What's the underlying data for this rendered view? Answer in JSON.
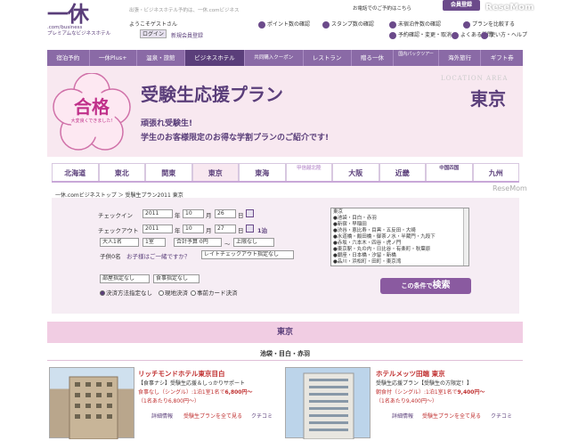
{
  "header": {
    "logo_main": "一休",
    "logo_sub1": ".com/business",
    "logo_sub2": "プレミアムなビジネスホテル",
    "top_crumb": "出張・ビジネスホテル予約は、一休.comビジネス",
    "guest_text": "ようこそゲストさん",
    "login_label": "ログイン",
    "register_label": "新規会員登録",
    "phone_text": "お電話でのご予約はこちら",
    "member_login": "会員登録",
    "links": [
      "ポイント数の確認",
      "スタンプ数の確認",
      "未宿泊件数の確認",
      "プランを比較する",
      "予約確認・変更・取消",
      "よくある質問",
      "使い方・ヘルプ"
    ]
  },
  "nav": {
    "items": [
      "宿泊予約",
      "一休Plus+",
      "温泉・旅館",
      "ビジネスホテル",
      "共同購入クーポン",
      "レストラン",
      "贈る一休",
      "国内パックツアー",
      "海外旅行",
      "ギフト券"
    ],
    "active_index": 3
  },
  "hero": {
    "badge_big": "合格",
    "badge_small": "大変良くできました!",
    "title": "受験生応援プラン",
    "sub1": "頑張れ受験生!",
    "sub2": "学生のお客様限定のお得な学割プランのご紹介です!",
    "location_area": "LOCATION AREA",
    "city": "東京"
  },
  "tabs": {
    "items": [
      "北海道",
      "東北",
      "関東",
      "東京",
      "東海",
      "甲信越北陸",
      "大阪",
      "近畿",
      "中国四国",
      "九州"
    ],
    "active_index": 3
  },
  "breadcrumb": "一休.comビジネストップ ＞ 受験生プラン2011 東京",
  "search": {
    "checkin_label": "チェックイン",
    "checkout_label": "チェックアウト",
    "checkin": {
      "year": "2011",
      "month": "10",
      "day": "26"
    },
    "checkout": {
      "year": "2011",
      "month": "10",
      "day": "27"
    },
    "year_unit": "年",
    "month_unit": "月",
    "day_unit": "日",
    "nights": "1泊",
    "adults": "大人1名",
    "rooms": "1室",
    "budget_min": "合計予算 0円",
    "tilde": "～",
    "budget_max": "上限なし",
    "children_label": "子供0名",
    "children_link": "お子様はご一緒ですか？",
    "late_checkout": "レイトチェックアウト指定なし",
    "breakfast": "部屋指定なし",
    "meal": "食事指定なし",
    "payment_options": [
      "決済方法指定なし",
      "現地決済",
      "事前カード決済"
    ],
    "payment_selected": 0,
    "area_list": [
      "東京",
      "●池袋・目白・赤羽",
      "●新宿・早稲田",
      "●渋谷・恵比寿・目黒・五反田・大崎",
      "●水道橋・飯田橋・御茶ノ水・半蔵門・九段下",
      "●赤坂・六本木・四谷・虎ノ門",
      "●東京駅・丸の内・日比谷・有楽町・秋葉原",
      "●銀座・日本橋・汐留・新橋",
      "●品川・浜松町・田町・東京湾"
    ],
    "search_prefix": "この条件で",
    "search_label": "検索"
  },
  "results": {
    "city": "東京",
    "subarea": "池袋・目白・赤羽",
    "hotels": [
      {
        "name": "リッチモンドホテル東京目白",
        "desc": "【食事ナシ】受験生応援＆しっかりサポート",
        "price_label": "食事なし（シングル）:1泊1室1名で",
        "price": "6,800円～",
        "price_orig": "（1名あたり6,800円～）",
        "btn_detail": "詳細情報",
        "btn_plans": "受験生プランを全て見る",
        "btn_review": "クチコミ"
      },
      {
        "name": "ホテルメッツ田端 東京",
        "desc": "受験生応援プラン【受験生の方限定！】",
        "price_label": "朝食付（シングル）:1泊1室1名で",
        "price": "9,400円～",
        "price_orig": "（1名あたり9,400円～）",
        "btn_detail": "詳細情報",
        "btn_plans": "受験生プランを全て見る",
        "btn_review": "クチコミ"
      }
    ]
  },
  "watermark": "ReseMom",
  "colors": {
    "brand": "#5a3e7a",
    "nav": "#8a6aa6",
    "hero_bg": "#f8e8f0",
    "price": "#c03030"
  }
}
